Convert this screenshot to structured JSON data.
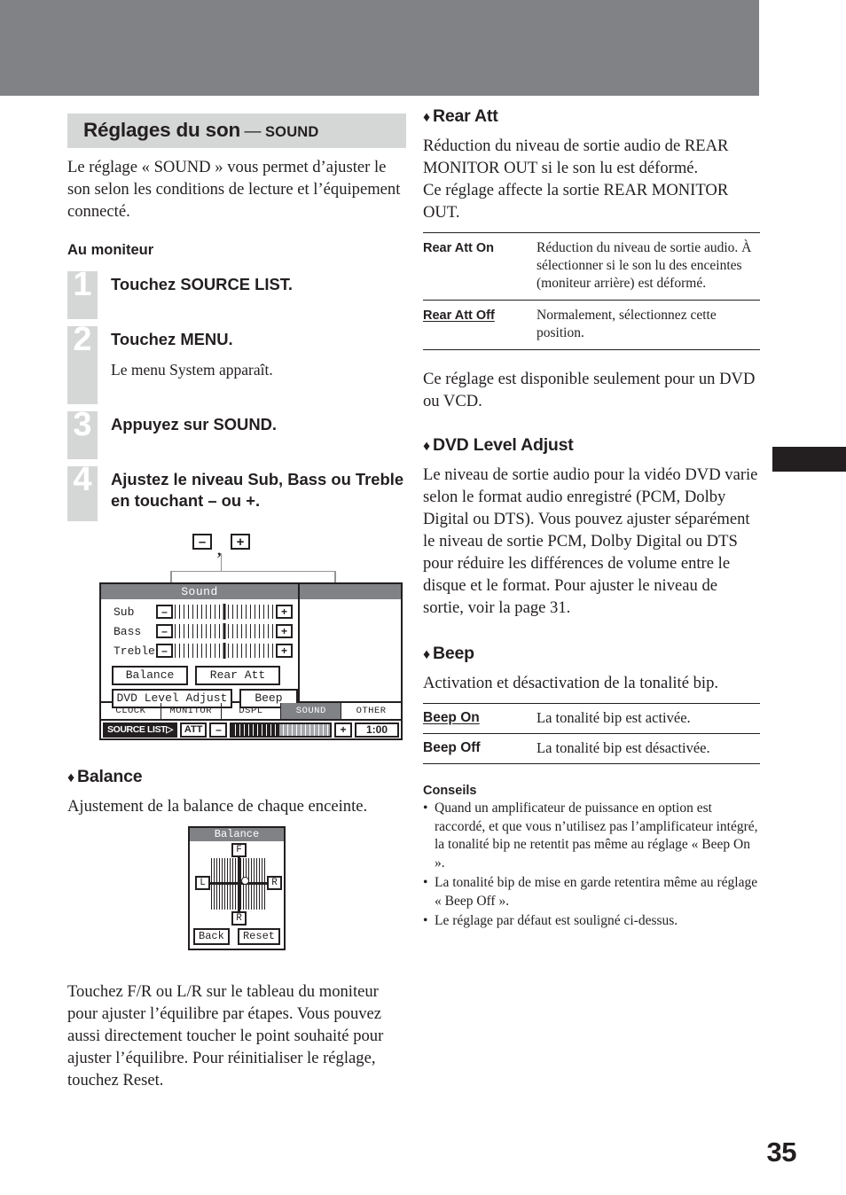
{
  "page": {
    "folio": "35"
  },
  "left": {
    "section_head": {
      "main": "Réglages du son",
      "dash": "—",
      "sub": "SOUND"
    },
    "intro": "Le réglage « SOUND » vous permet d’ajuster le son selon les conditions de lecture et l’équipement connecté.",
    "subhead": "Au moniteur",
    "steps": [
      {
        "num": "1",
        "title": "Touchez SOURCE LIST.",
        "note": ""
      },
      {
        "num": "2",
        "title": "Touchez MENU.",
        "note": "Le menu System apparaît."
      },
      {
        "num": "3",
        "title": "Appuyez sur SOUND.",
        "note": ""
      },
      {
        "num": "4",
        "title": "Ajustez le niveau Sub, Bass ou Treble en touchant – ou +.",
        "note": ""
      }
    ],
    "lcd_sound": {
      "callout_minus": "–",
      "callout_plus": "+",
      "callout_comma": ",",
      "title": "Sound",
      "rows": [
        {
          "label": "Sub",
          "minus": "–",
          "plus": "+"
        },
        {
          "label": "Bass",
          "minus": "–",
          "plus": "+"
        },
        {
          "label": "Treble",
          "minus": "–",
          "plus": "+"
        }
      ],
      "buttons": {
        "balance": "Balance",
        "rear_att": "Rear Att",
        "dvd_level_adjust": "DVD Level Adjust",
        "beep": "Beep"
      },
      "tabs": [
        {
          "label": "CLOCK",
          "active": false
        },
        {
          "label": "MONITOR",
          "active": false
        },
        {
          "label": "DSPL",
          "active": false
        },
        {
          "label": "SOUND",
          "active": true
        },
        {
          "label": "OTHER",
          "active": false
        }
      ],
      "bottom": {
        "source_list": "SOURCE LIST▷",
        "att": "ATT",
        "minus": "–",
        "plus": "+",
        "clock": "1:00"
      }
    },
    "balance_section": {
      "diamond": "♦",
      "heading": "Balance",
      "desc": "Ajustement de la balance de chaque enceinte.",
      "lcd": {
        "title": "Balance",
        "front": "F",
        "rear": "R",
        "left": "L",
        "right": "R",
        "back_btn": "Back",
        "reset_btn": "Reset"
      },
      "after_text": "Touchez F/R ou L/R sur le tableau du moniteur pour ajuster l’équilibre par étapes. Vous pouvez aussi directement toucher le point souhaité pour ajuster l’équilibre. Pour réinitialiser le réglage, touchez Reset."
    }
  },
  "right": {
    "rear_att": {
      "diamond": "♦",
      "heading": "Rear Att",
      "desc1": "Réduction du niveau de sortie audio de REAR MONITOR OUT si le son lu est déformé.",
      "desc2": "Ce réglage affecte la sortie REAR MONITOR OUT.",
      "table": [
        {
          "term": "Rear Att On",
          "underlined": false,
          "desc": "Réduction du niveau de sortie audio. À sélectionner si le son lu des enceintes (moniteur arrière) est déformé."
        },
        {
          "term": "Rear Att Off",
          "underlined": true,
          "desc": "Normalement, sélectionnez cette position."
        }
      ],
      "note": "Ce réglage est disponible seulement pour un DVD ou VCD."
    },
    "dvd_level": {
      "diamond": "♦",
      "heading": "DVD Level Adjust",
      "desc": "Le niveau de sortie audio pour la vidéo DVD varie selon le format audio enregistré (PCM, Dolby Digital ou DTS). Vous pouvez ajuster séparément le niveau de sortie PCM, Dolby Digital ou DTS pour réduire les différences de volume entre le disque et le format. Pour ajuster le niveau de sortie, voir la page 31."
    },
    "beep": {
      "diamond": "♦",
      "heading": "Beep",
      "desc": "Activation et désactivation de la tonalité bip.",
      "table": [
        {
          "term": "Beep On",
          "underlined": true,
          "desc": "La tonalité bip est activée."
        },
        {
          "term": "Beep Off",
          "underlined": false,
          "desc": "La tonalité bip est désactivée."
        }
      ]
    },
    "tips": {
      "heading": "Conseils",
      "items": [
        "Quand un amplificateur de puissance en option est raccordé, et que vous n’utilisez pas l’amplificateur intégré, la tonalité bip ne retentit pas même au réglage « Beep On ».",
        "La tonalité bip de mise en garde retentira même au réglage « Beep Off ».",
        "Le réglage par défaut est souligné ci-dessus."
      ]
    }
  }
}
